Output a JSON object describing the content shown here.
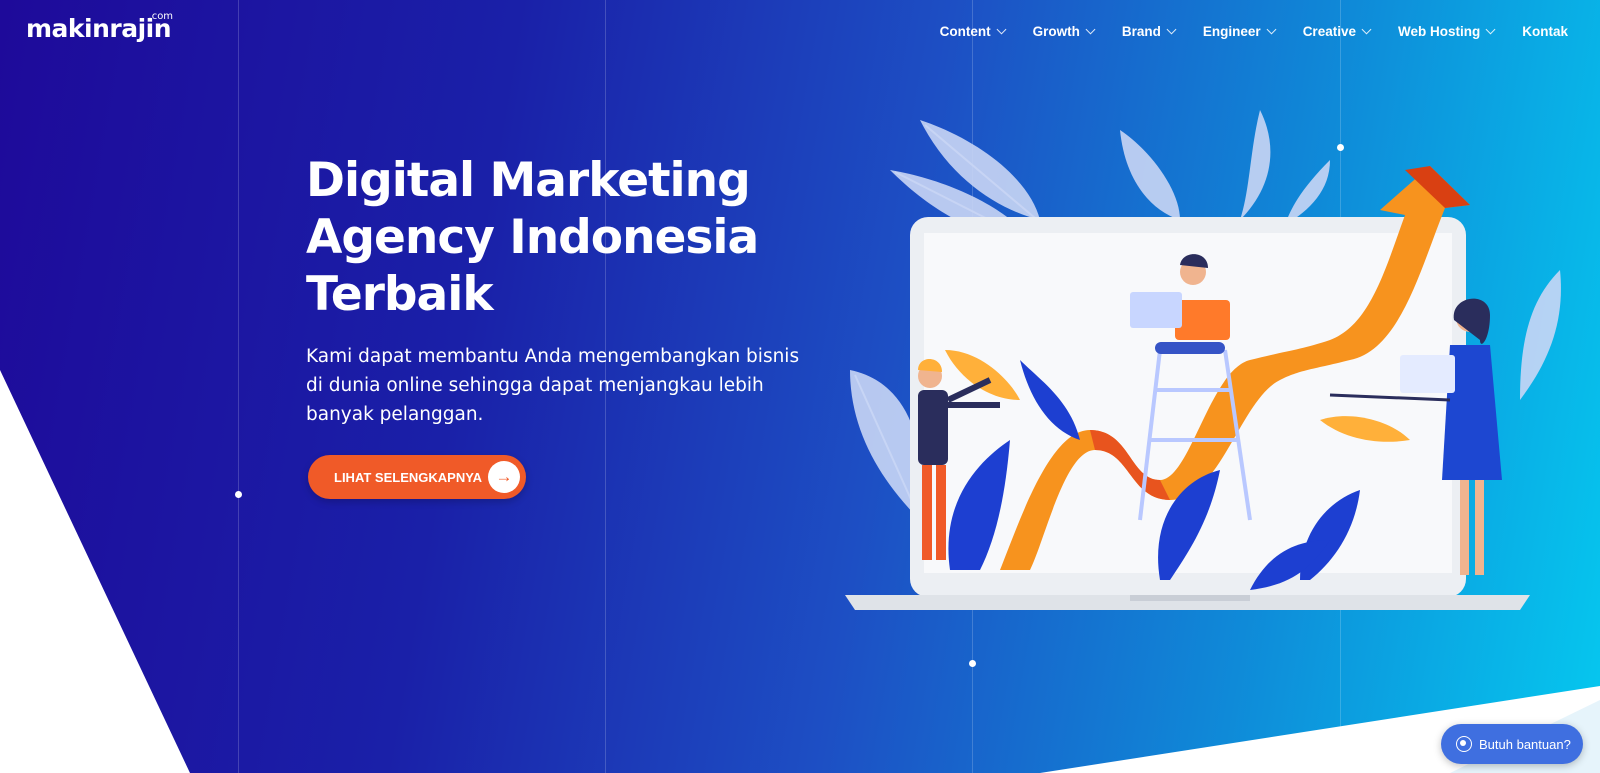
{
  "brand": {
    "name": "makinrajin",
    "tld": ".com"
  },
  "nav": {
    "items": [
      {
        "label": "Content",
        "has_dropdown": true
      },
      {
        "label": "Growth",
        "has_dropdown": true
      },
      {
        "label": "Brand",
        "has_dropdown": true
      },
      {
        "label": "Engineer",
        "has_dropdown": true
      },
      {
        "label": "Creative",
        "has_dropdown": true
      },
      {
        "label": "Web Hosting",
        "has_dropdown": true
      },
      {
        "label": "Kontak",
        "has_dropdown": false
      }
    ]
  },
  "hero": {
    "title_lines": [
      "Digital Marketing",
      "Agency Indonesia",
      "Terbaik"
    ],
    "description_lines": [
      "Kami dapat membantu Anda mengembangkan bisnis",
      "di dunia online sehingga dapat menjangkau lebih",
      "banyak pelanggan."
    ],
    "cta_label": "LIHAT SELENGKAPNYA",
    "cta_icon": "arrow-right-icon"
  },
  "help_widget": {
    "label": "Butuh bantuan?",
    "icon": "whatsapp-icon"
  },
  "colors": {
    "gradient_start": "#1e0a9a",
    "gradient_end": "#05c8ef",
    "cta": "#f05a28",
    "help_button": "#3f6fe0"
  }
}
